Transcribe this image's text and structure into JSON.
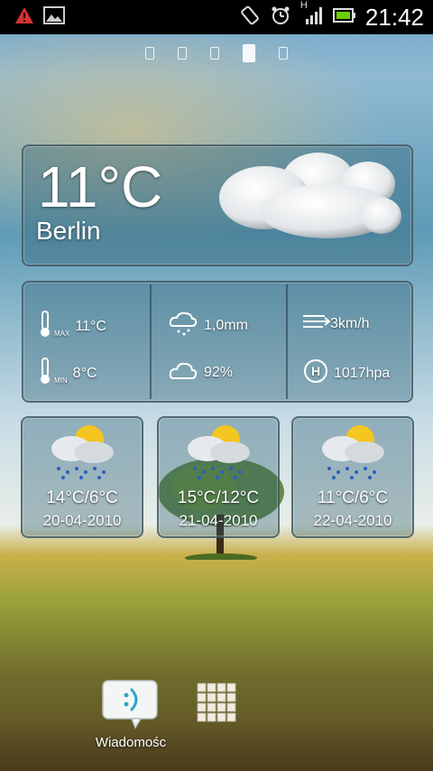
{
  "status_bar": {
    "time": "21:42",
    "network_type": "H",
    "icons": [
      "warning-icon",
      "gallery-icon",
      "rotation-icon",
      "alarm-icon",
      "signal-icon",
      "battery-icon"
    ]
  },
  "pager": {
    "pages": 5,
    "active_index": 3
  },
  "current_weather": {
    "temperature": "11°C",
    "city": "Berlin",
    "condition_icon": "cloud-icon"
  },
  "details": {
    "max_temp": "11°C",
    "min_temp": "8°C",
    "max_label": "MAX",
    "min_label": "MIN",
    "precipitation": "1,0mm",
    "humidity": "92%",
    "wind": "3km/h",
    "pressure": "1017hpa"
  },
  "forecast": [
    {
      "temp": "14°C/6°C",
      "date": "20-04-2010",
      "icon": "rain-sun-icon"
    },
    {
      "temp": "15°C/12°C",
      "date": "21-04-2010",
      "icon": "rain-sun-icon"
    },
    {
      "temp": "11°C/6°C",
      "date": "22-04-2010",
      "icon": "rain-sun-icon"
    }
  ],
  "dock": {
    "messaging_label": "Wiadomośc",
    "apps_icon": "app-drawer-icon"
  },
  "colors": {
    "status_bar_bg": "#000000",
    "battery_green": "#6cd000",
    "warning_red": "#d43030"
  }
}
